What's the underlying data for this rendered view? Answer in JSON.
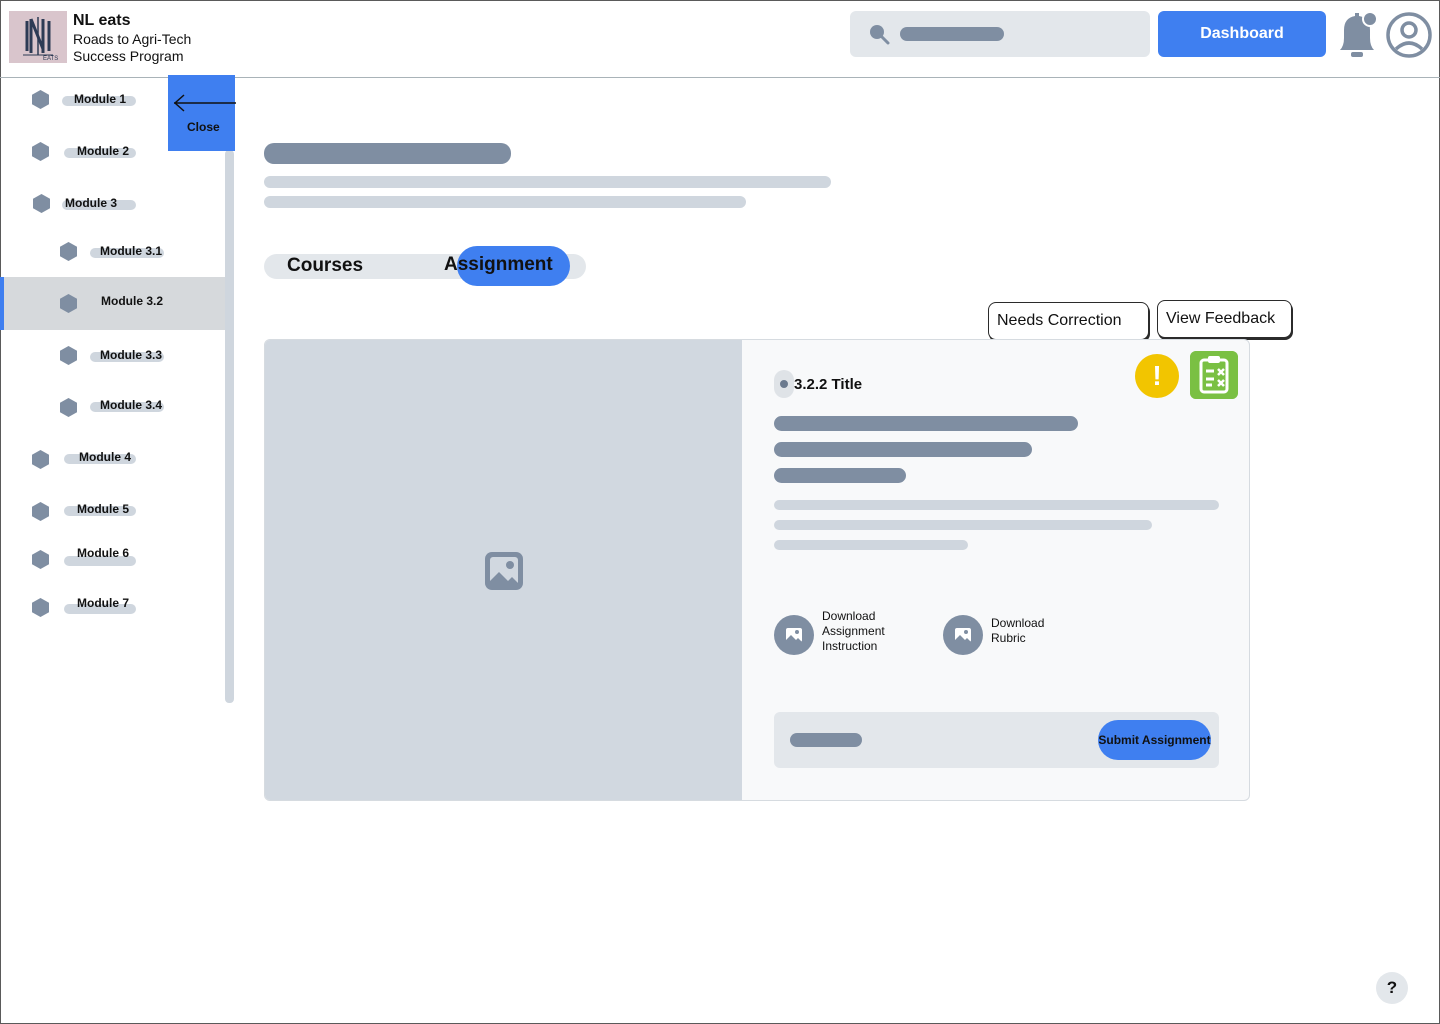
{
  "header": {
    "brand_title": "NL eats",
    "brand_subtitle": "Roads to Agri-Tech Success Program",
    "dashboard_label": "Dashboard"
  },
  "sidebar": {
    "close_label": "Close",
    "items": [
      {
        "label": "Module 1",
        "level": 1,
        "active": false
      },
      {
        "label": "Module 2",
        "level": 1,
        "active": false
      },
      {
        "label": "Module 3",
        "level": 1,
        "active": false
      },
      {
        "label": "Module 3.1",
        "level": 2,
        "active": false
      },
      {
        "label": "Module 3.2",
        "level": 2,
        "active": true
      },
      {
        "label": "Module 3.3",
        "level": 2,
        "active": false
      },
      {
        "label": "Module 3.4",
        "level": 2,
        "active": false
      },
      {
        "label": "Module 4",
        "level": 1,
        "active": false
      },
      {
        "label": "Module 5",
        "level": 1,
        "active": false
      },
      {
        "label": "Module 6",
        "level": 1,
        "active": false
      },
      {
        "label": "Module 7",
        "level": 1,
        "active": false
      }
    ]
  },
  "tabs": {
    "courses": "Courses",
    "assignment": "Assignment",
    "active": "assignment"
  },
  "chips": {
    "needs_correction": "Needs Correction",
    "view_feedback": "View Feedback"
  },
  "card": {
    "title": "3.2.2 Title",
    "download_instruction": "Download Assignment Instruction",
    "download_rubric": "Download Rubric",
    "submit_label": "Submit Assignment",
    "status_icon": "warning-icon",
    "clipboard_icon": "clipboard-x-icon"
  },
  "help_label": "?",
  "colors": {
    "accent": "#3f7ff0",
    "placeholder_dark": "#7f8ea2",
    "placeholder_light": "#cfd6de",
    "warning": "#f2c500",
    "success": "#7ac043"
  }
}
